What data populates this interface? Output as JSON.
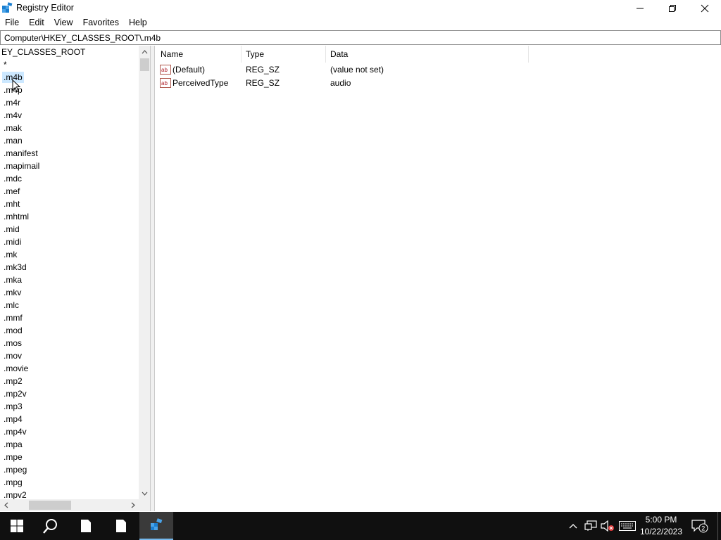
{
  "window": {
    "title": "Registry Editor"
  },
  "menu": {
    "items": [
      "File",
      "Edit",
      "View",
      "Favorites",
      "Help"
    ]
  },
  "address": {
    "path": "Computer\\HKEY_CLASSES_ROOT\\.m4b"
  },
  "tree": {
    "root_label": "EY_CLASSES_ROOT",
    "items": [
      "*",
      ".m4b",
      ".m4p",
      ".m4r",
      ".m4v",
      ".mak",
      ".man",
      ".manifest",
      ".mapimail",
      ".mdc",
      ".mef",
      ".mht",
      ".mhtml",
      ".mid",
      ".midi",
      ".mk",
      ".mk3d",
      ".mka",
      ".mkv",
      ".mlc",
      ".mmf",
      ".mod",
      ".mos",
      ".mov",
      ".movie",
      ".mp2",
      ".mp2v",
      ".mp3",
      ".mp4",
      ".mp4v",
      ".mpa",
      ".mpe",
      ".mpeg",
      ".mpg",
      ".mpv2"
    ],
    "selected": ".m4b"
  },
  "values": {
    "columns": {
      "name": "Name",
      "type": "Type",
      "data": "Data"
    },
    "rows": [
      {
        "name": "(Default)",
        "type": "REG_SZ",
        "data": "(value not set)",
        "icon": "string-value-icon"
      },
      {
        "name": "PerceivedType",
        "type": "REG_SZ",
        "data": "audio",
        "icon": "string-value-icon"
      }
    ]
  },
  "taskbar": {
    "time": "5:00 PM",
    "date": "10/22/2023",
    "notification_count": "2"
  },
  "colors": {
    "selection": "#cce8ff",
    "taskbar": "#101010",
    "active_app_underline": "#76b9ed"
  }
}
